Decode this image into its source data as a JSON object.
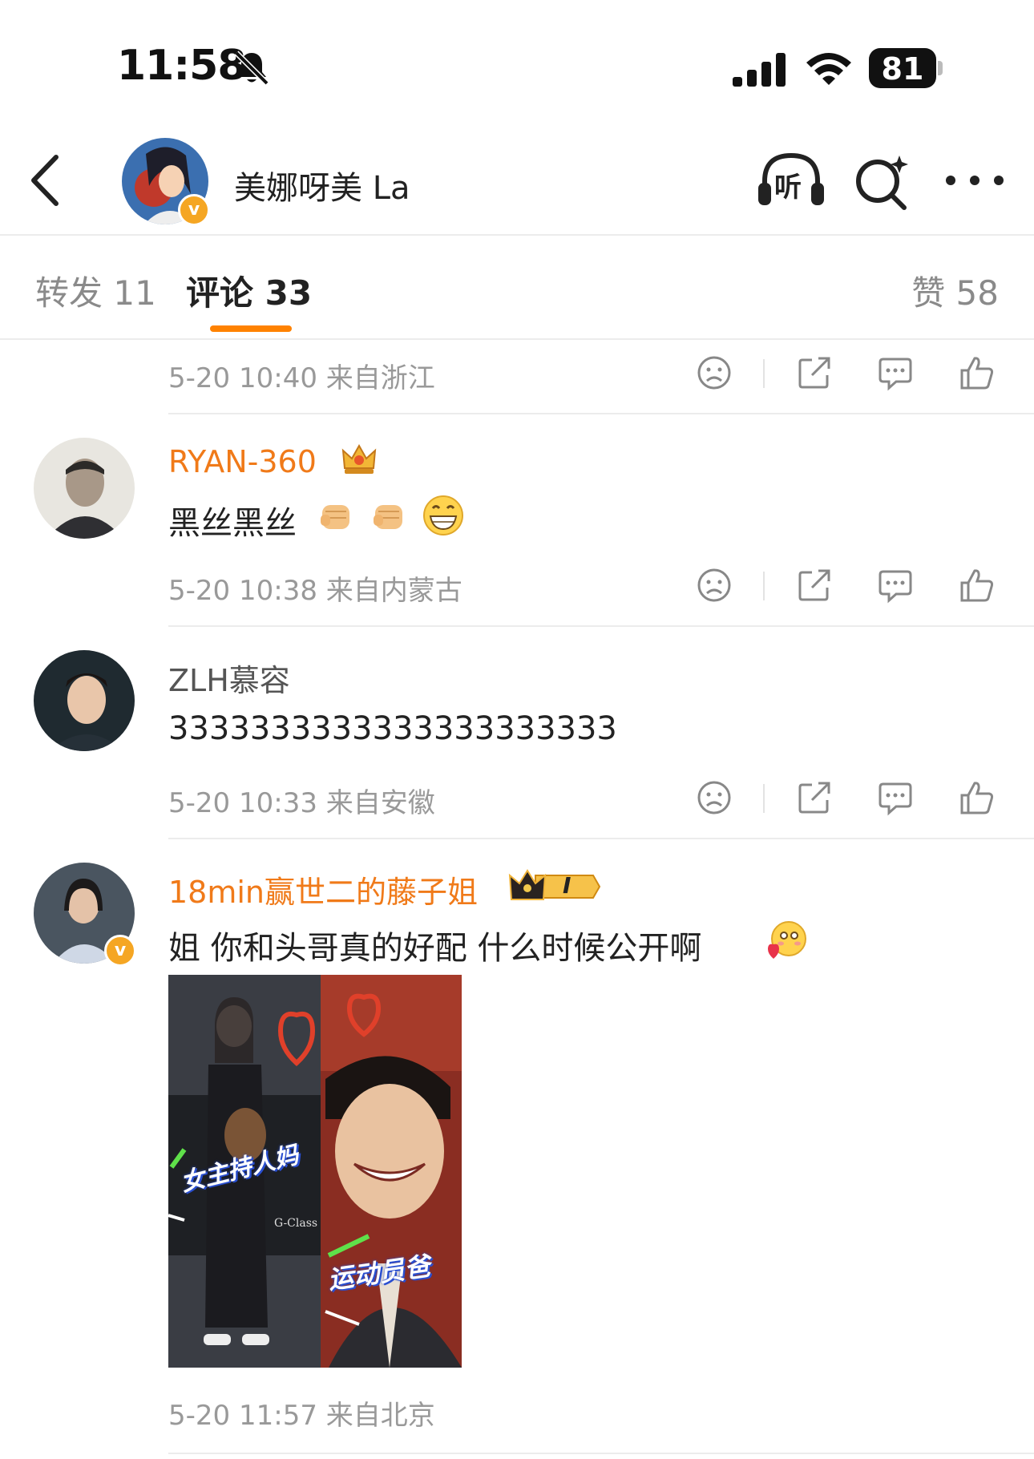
{
  "status_bar": {
    "time": "11:58",
    "battery": "81"
  },
  "header": {
    "title": "美娜呀美 La",
    "listen_label": "听"
  },
  "tabs": {
    "reposts": "转发 11",
    "comments": "评论 33",
    "likes": "赞 58"
  },
  "comments": [
    {
      "meta": "5-20 10:40  来自浙江"
    },
    {
      "user": "RYAN-360",
      "text": "黑丝黑丝",
      "meta": "5-20 10:38  来自内蒙古"
    },
    {
      "user": "ZLH慕容",
      "text": "3333333333333333333333",
      "meta": "5-20 10:33  来自安徽"
    },
    {
      "user": "18min赢世二的藤子姐",
      "vip_level": "I",
      "text": "姐 你和头哥真的好配 什么时候公开啊",
      "meta": "5-20 11:57  来自北京",
      "photo_labels": {
        "left": "女主持人妈",
        "right": "运动员爸",
        "brand": "G-Class"
      }
    }
  ],
  "colors": {
    "accent": "#ff8200",
    "vip_name": "#f07a19",
    "verified": "#f5a623"
  }
}
